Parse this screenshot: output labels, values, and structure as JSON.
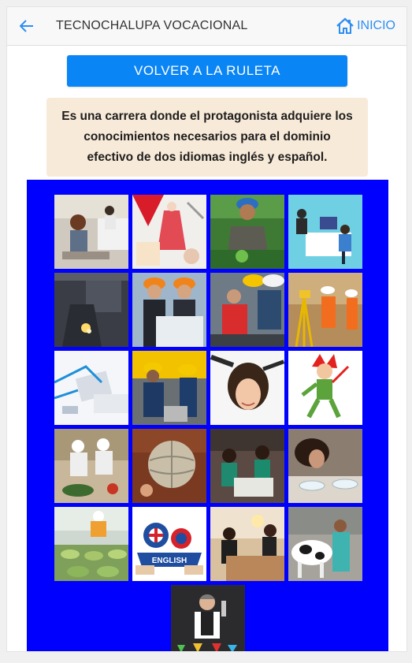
{
  "appbar": {
    "title": "TECNOCHALUPA VOCACIONAL",
    "home_label": "INICIO",
    "accent_color": "#2d8ef0"
  },
  "cta": {
    "label": "VOLVER A LA RULETA",
    "color": "#0a85f5"
  },
  "description": "Es una carrera donde el protagonista adquiere los conocimientos necesarios para el dominio efectivo de dos idiomas inglés y español.",
  "grid": {
    "background": "#0000ff",
    "tiles": [
      {
        "name": "office-typing-image"
      },
      {
        "name": "fashion-design-image"
      },
      {
        "name": "agriculture-image"
      },
      {
        "name": "office-illustration-image"
      },
      {
        "name": "welding-image"
      },
      {
        "name": "engineers-blueprint-image"
      },
      {
        "name": "mechanics-workshop-image"
      },
      {
        "name": "surveying-image"
      },
      {
        "name": "accounting-calculator-image"
      },
      {
        "name": "industrial-maintenance-image"
      },
      {
        "name": "hairdressing-image"
      },
      {
        "name": "jester-cartoon-image"
      },
      {
        "name": "food-lab-image"
      },
      {
        "name": "globe-craft-image"
      },
      {
        "name": "sewing-students-image"
      },
      {
        "name": "laboratory-students-image"
      },
      {
        "name": "food-processing-image"
      },
      {
        "name": "english-badge-image",
        "text": "ENGLISH"
      },
      {
        "name": "hotel-reception-image"
      },
      {
        "name": "veterinary-cow-image"
      },
      {
        "name": "bartender-image"
      }
    ]
  }
}
